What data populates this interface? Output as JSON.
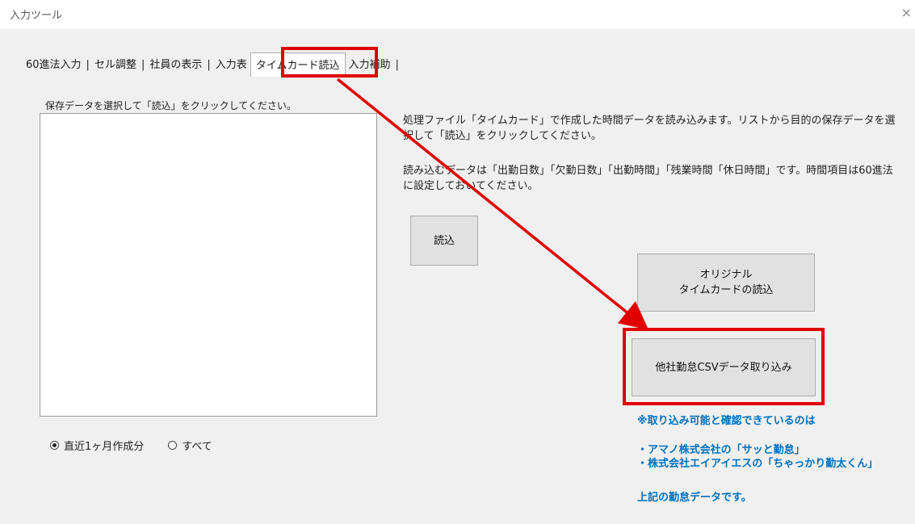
{
  "window": {
    "title": "入力ツール",
    "close_glyph": "×"
  },
  "tabs": [
    {
      "label": "60進法入力"
    },
    {
      "label": "セル調整"
    },
    {
      "label": "社員の表示"
    },
    {
      "label": "入力表"
    },
    {
      "label": "タイムカード読込",
      "active": true
    },
    {
      "label": "入力補助"
    }
  ],
  "tab_separator": "|",
  "list": {
    "caption": "保存データを選択して「読込」をクリックしてください。"
  },
  "description": {
    "line1": "処理ファイル「タイムカード」で作成した時間データを読み込みます。リストから目的の保存データを選択して「読込」をクリックしてください。",
    "line2": "読み込むデータは「出勤日数」「欠勤日数」「出勤時間」「残業時間「休日時間」です。時間項目は60進法に設定しておいてください。"
  },
  "buttons": {
    "read": "読込",
    "original_line1": "オリジナル",
    "original_line2": "タイムカードの読込",
    "csv": "他社勤怠CSVデータ取り込み"
  },
  "radios": [
    {
      "label": "直近1ヶ月作成分",
      "checked": true
    },
    {
      "label": "すべて",
      "checked": false
    }
  ],
  "notes": {
    "confirmed": "※取り込み可能と確認できているのは",
    "vendor1": "・アマノ株式会社の「サッと勤怠」",
    "vendor2": "・株式会社エイアイエスの「ちゃっかり勤太くん」",
    "footer": "上記の勤怠データです。"
  },
  "colors": {
    "highlight": "#e00000",
    "note_text": "#0070c0",
    "client_bg": "#f0f0f0"
  }
}
